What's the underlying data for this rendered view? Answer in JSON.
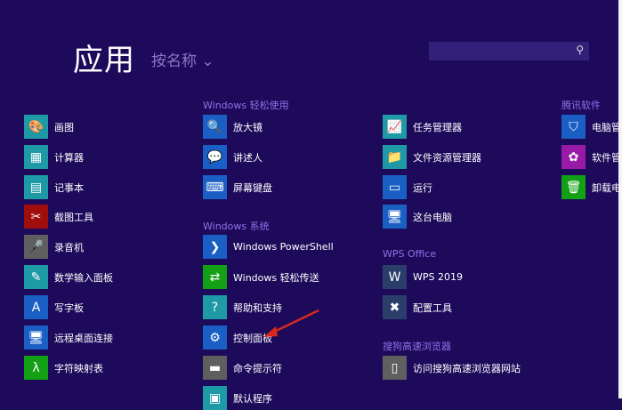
{
  "header": {
    "title": "应用",
    "sort_label": "按名称",
    "sort_chevron": "⌄",
    "search_placeholder": ""
  },
  "groups": [
    {
      "header": null,
      "items": [
        {
          "label": "画图",
          "icon": "paint-icon",
          "color": "#1e9aa6",
          "glyph": "🎨"
        },
        {
          "label": "计算器",
          "icon": "calculator-icon",
          "color": "#1e9aa6",
          "glyph": "▦"
        },
        {
          "label": "记事本",
          "icon": "notepad-icon",
          "color": "#1e9aa6",
          "glyph": "▤"
        },
        {
          "label": "截图工具",
          "icon": "snipping-tool-icon",
          "color": "#a00d0d",
          "glyph": "✂"
        },
        {
          "label": "录音机",
          "icon": "sound-recorder-icon",
          "color": "#5f5f5f",
          "glyph": "🎤"
        },
        {
          "label": "数学输入面板",
          "icon": "math-input-icon",
          "color": "#1e9aa6",
          "glyph": "✎"
        },
        {
          "label": "写字板",
          "icon": "wordpad-icon",
          "color": "#1a5fc4",
          "glyph": "A"
        },
        {
          "label": "远程桌面连接",
          "icon": "remote-desktop-icon",
          "color": "#1a5fc4",
          "glyph": "🖥"
        },
        {
          "label": "字符映射表",
          "icon": "character-map-icon",
          "color": "#14a014",
          "glyph": "λ"
        }
      ]
    },
    {
      "header": "Windows 轻松使用",
      "items": [
        {
          "label": "放大镜",
          "icon": "magnifier-icon",
          "color": "#1a5fc4",
          "glyph": "🔍"
        },
        {
          "label": "讲述人",
          "icon": "narrator-icon",
          "color": "#1a5fc4",
          "glyph": "💬"
        },
        {
          "label": "屏幕键盘",
          "icon": "on-screen-keyboard-icon",
          "color": "#1a5fc4",
          "glyph": "⌨"
        }
      ]
    },
    {
      "header": "Windows 系统",
      "items": [
        {
          "label": "Windows PowerShell",
          "icon": "powershell-icon",
          "color": "#1a5fc4",
          "glyph": "❯"
        },
        {
          "label": "Windows 轻松传送",
          "icon": "easy-transfer-icon",
          "color": "#14a014",
          "glyph": "⇄"
        },
        {
          "label": "帮助和支持",
          "icon": "help-icon",
          "color": "#1e9aa6",
          "glyph": "?"
        },
        {
          "label": "控制面板",
          "icon": "control-panel-icon",
          "color": "#1a5fc4",
          "glyph": "⚙"
        },
        {
          "label": "命令提示符",
          "icon": "command-prompt-icon",
          "color": "#5f5f5f",
          "glyph": "▬"
        },
        {
          "label": "默认程序",
          "icon": "default-programs-icon",
          "color": "#1e9aa6",
          "glyph": "▣"
        }
      ]
    },
    {
      "header": null,
      "items": [
        {
          "label": "任务管理器",
          "icon": "task-manager-icon",
          "color": "#1e9aa6",
          "glyph": "📈"
        },
        {
          "label": "文件资源管理器",
          "icon": "file-explorer-icon",
          "color": "#1e9aa6",
          "glyph": "📁"
        },
        {
          "label": "运行",
          "icon": "run-icon",
          "color": "#1a5fc4",
          "glyph": "▭"
        },
        {
          "label": "这台电脑",
          "icon": "this-pc-icon",
          "color": "#1a5fc4",
          "glyph": "🖥"
        }
      ]
    },
    {
      "header": "WPS Office",
      "items": [
        {
          "label": "WPS 2019",
          "icon": "wps-icon",
          "color": "#2b3d6b",
          "glyph": "W"
        },
        {
          "label": "配置工具",
          "icon": "config-tool-icon",
          "color": "#2b3d6b",
          "glyph": "✖"
        }
      ]
    },
    {
      "header": "搜狗高速浏览器",
      "items": [
        {
          "label": "访问搜狗高速浏览器网站",
          "icon": "document-icon",
          "color": "#5f5f5f",
          "glyph": "▯"
        }
      ]
    },
    {
      "header": "腾讯软件",
      "items": [
        {
          "label": "电脑管",
          "icon": "pc-manager-icon",
          "color": "#1a5fc4",
          "glyph": "⛉"
        },
        {
          "label": "软件管",
          "icon": "software-manager-icon",
          "color": "#9a1aa8",
          "glyph": "✿"
        },
        {
          "label": "卸载电",
          "icon": "uninstall-icon",
          "color": "#14a014",
          "glyph": "🗑"
        }
      ]
    }
  ]
}
